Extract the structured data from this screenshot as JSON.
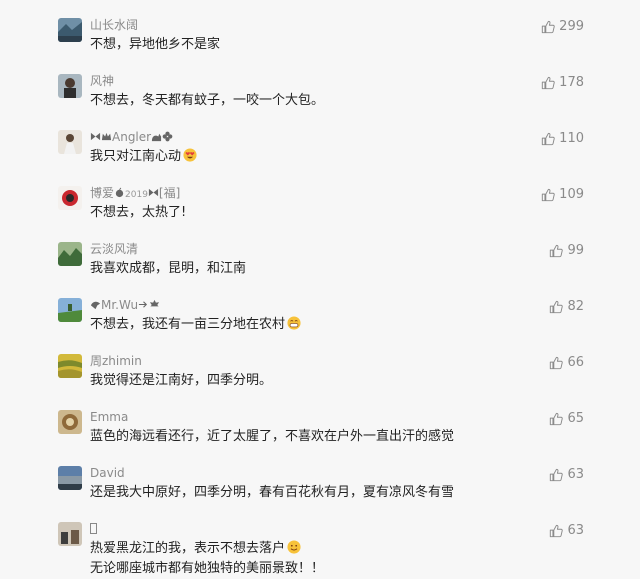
{
  "colors": {
    "accent_text": "#8a8a8a",
    "body_text": "#222222",
    "background": "#f7f7f7"
  },
  "icons": {
    "like": "thumbs-up-icon"
  },
  "comments": [
    {
      "user": "山长水阔",
      "text": "不想，异地他乡不是家",
      "likes": "299"
    },
    {
      "user": "风神",
      "text": "不想去，冬天都有蚊子，一咬一个大包。",
      "likes": "178"
    },
    {
      "user": "Angler",
      "text": "我只对江南心动",
      "likes": "110"
    },
    {
      "user": "博爱",
      "user_small": "2019",
      "user_tag": "[福]",
      "text": "不想去，太热了!",
      "likes": "109"
    },
    {
      "user": "云淡风清",
      "text": "我喜欢成都，昆明，和江南",
      "likes": "99"
    },
    {
      "user": "Mr.Wu",
      "text": "不想去，我还有一亩三分地在农村",
      "likes": "82"
    },
    {
      "user": "周zhimin",
      "text": "我觉得还是江南好，四季分明。",
      "likes": "66"
    },
    {
      "user": "Emma",
      "text": "蓝色的海远看还行，近了太腥了，不喜欢在户外一直出汗的感觉",
      "likes": "65"
    },
    {
      "user": "David",
      "text": "还是我大中原好，四季分明，春有百花秋有月，夏有凉风冬有雪",
      "likes": "63"
    },
    {
      "user": "",
      "text": "热爱黑龙江的我，表示不想去落户",
      "text2": "无论哪座城市都有她独特的美丽景致！！",
      "likes": "63"
    }
  ]
}
